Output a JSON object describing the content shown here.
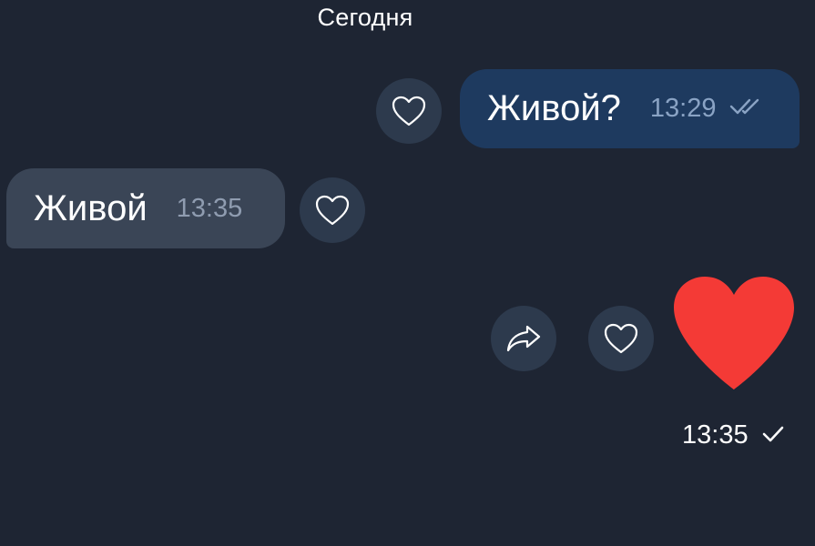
{
  "header": {
    "date_label": "Сегодня"
  },
  "messages": [
    {
      "direction": "outgoing",
      "text": "Живой?",
      "time": "13:29",
      "status": "read"
    },
    {
      "direction": "incoming",
      "text": "Живой",
      "time": "13:35"
    },
    {
      "direction": "outgoing",
      "kind": "sticker",
      "sticker": "heart",
      "time": "13:35",
      "status": "sent"
    }
  ],
  "icons": {
    "reaction": "heart-outline-icon",
    "share": "share-arrow-icon",
    "read": "double-check-icon",
    "sent": "check-icon"
  },
  "colors": {
    "background": "#1e2533",
    "outgoing_bubble": "#1e3a5f",
    "incoming_bubble": "#3a4556",
    "reaction_button": "#2d3a4d",
    "heart_sticker": "#f43a36"
  }
}
